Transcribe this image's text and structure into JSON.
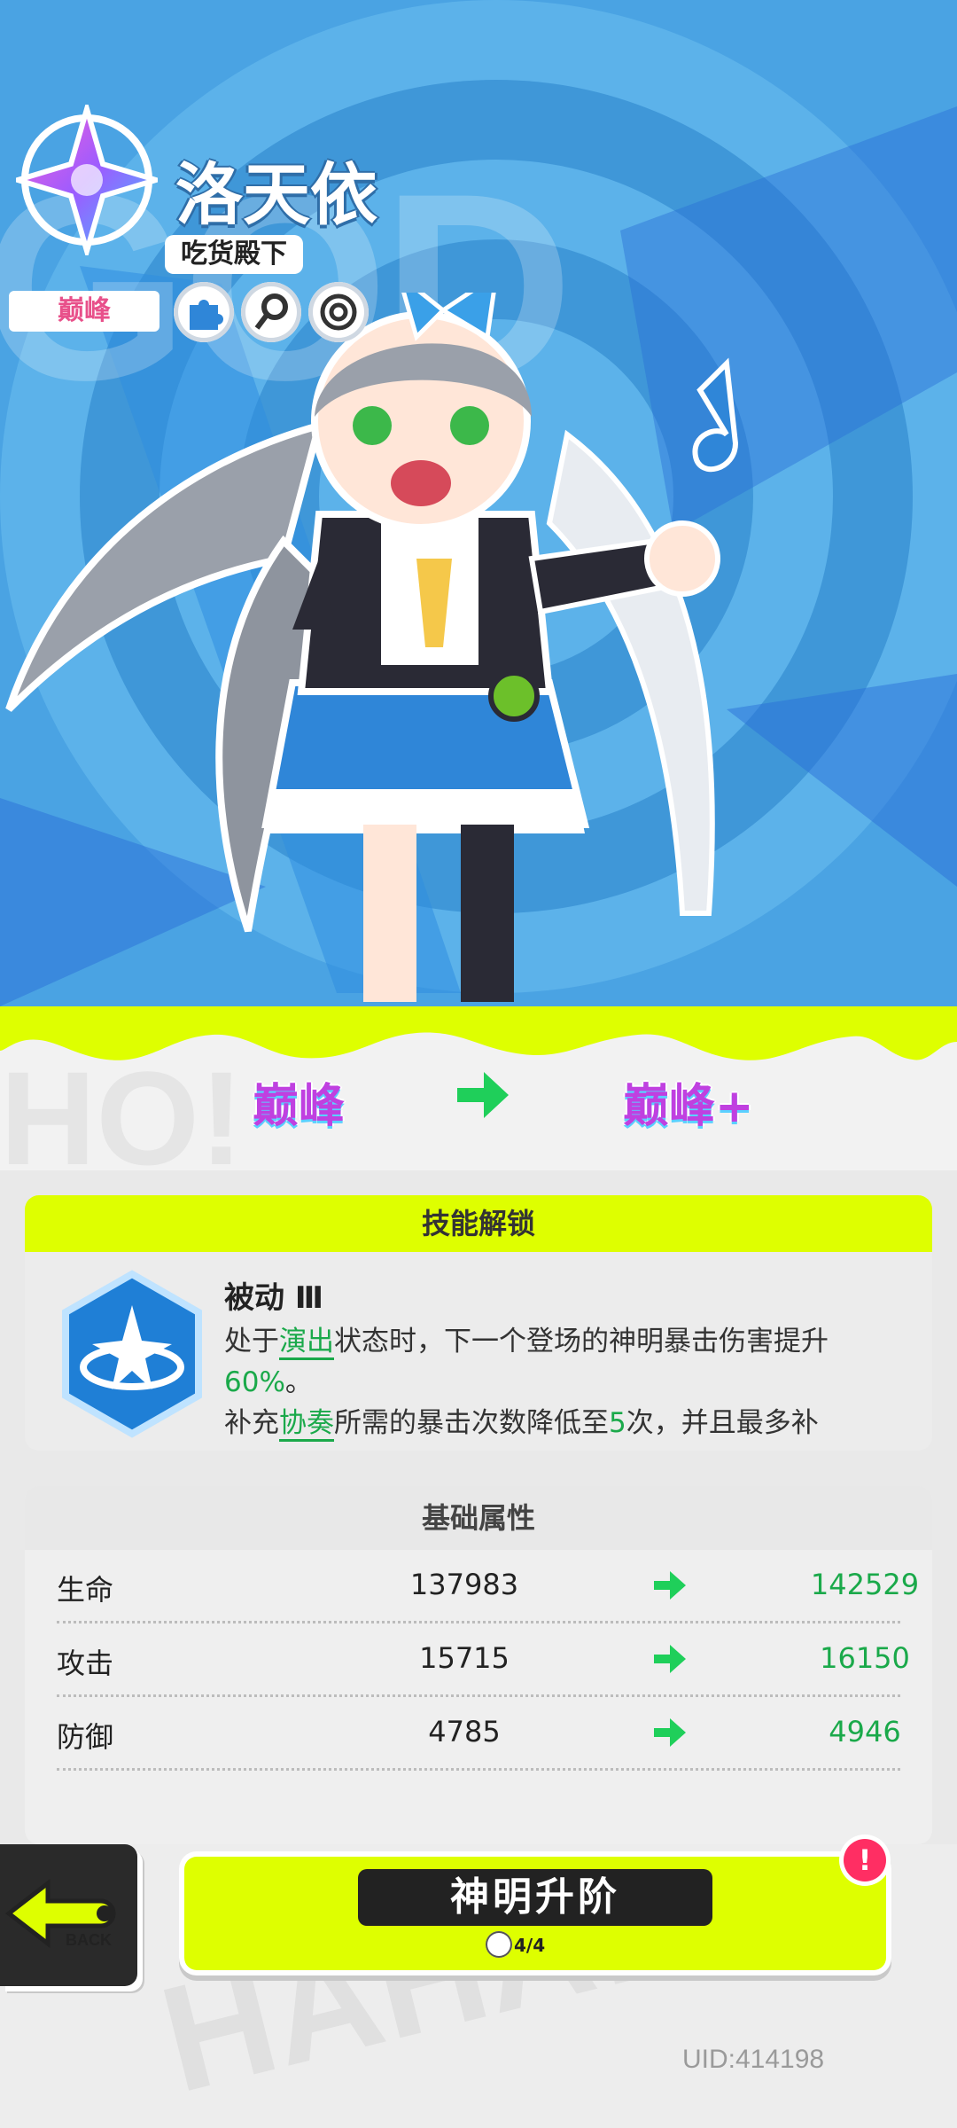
{
  "hero": {
    "background_text": "GOD",
    "character_name": "洛天依",
    "character_title": "吃货殿下",
    "rank_label": "巅峰",
    "tags": [
      {
        "icon": "puzzle-icon"
      },
      {
        "icon": "key-icon"
      },
      {
        "icon": "target-icon"
      }
    ]
  },
  "upgrade": {
    "from_rank": "巅峰",
    "to_rank": "巅峰+"
  },
  "skill_panel": {
    "header": "技能解锁",
    "skill_name": "被动 Ⅲ",
    "desc_line1_a": "处于",
    "desc_line1_hl": "演出",
    "desc_line1_b": "状态时，下一个登场的神明暴击伤害提升",
    "desc_line2_hl": "60%",
    "desc_line2_b": "。",
    "desc_line3_a": "补充",
    "desc_line3_hl": "协奏",
    "desc_line3_b": "所需的暴击次数降低至",
    "desc_line3_num": "5",
    "desc_line3_c": "次，并且最多补"
  },
  "stats_panel": {
    "header": "基础属性",
    "rows": [
      {
        "label": "生命",
        "current": "137983",
        "next": "142529"
      },
      {
        "label": "攻击",
        "current": "15715",
        "next": "16150"
      },
      {
        "label": "防御",
        "current": "4785",
        "next": "4946"
      }
    ]
  },
  "footer": {
    "back_label": "BACK",
    "ascend_label": "神明升阶",
    "ascend_progress": "4/4",
    "alert": "!",
    "uid": "UID:414198"
  },
  "colors": {
    "accent_lime": "#deff00",
    "increase_green": "#1aa94a",
    "hero_blue": "#4aa3e3"
  }
}
